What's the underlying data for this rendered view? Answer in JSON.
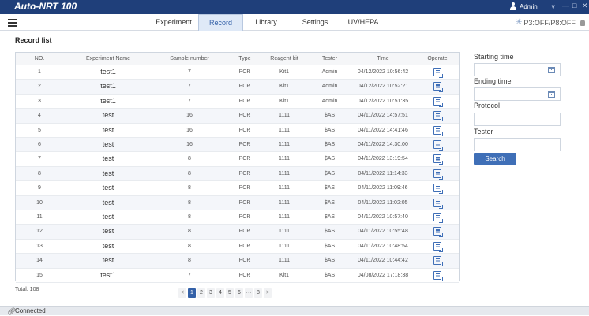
{
  "app": {
    "title": "Auto-NRT 100",
    "user": "Admin",
    "chevron": "∨",
    "win_controls": [
      "—",
      "□",
      "✕"
    ]
  },
  "nav": {
    "menu_icon": "hamburger-icon",
    "tabs": [
      {
        "label": "Experiment",
        "active": false
      },
      {
        "label": "Record",
        "active": true
      },
      {
        "label": "Library",
        "active": false
      },
      {
        "label": "Settings",
        "active": false
      },
      {
        "label": "UV/HEPA",
        "active": false
      }
    ],
    "status": "P3:OFF/P8:OFF"
  },
  "record_list": {
    "title": "Record list",
    "columns": [
      "NO.",
      "Experiment Name",
      "Sample number",
      "Type",
      "Reagent kit",
      "Tester",
      "Time",
      "Operate"
    ],
    "rows": [
      [
        "1",
        "test1",
        "7",
        "PCR",
        "Kit1",
        "Admin",
        "04/12/2022 10:56:42"
      ],
      [
        "2",
        "test1",
        "7",
        "PCR",
        "Kit1",
        "Admin",
        "04/12/2022 10:52:21"
      ],
      [
        "3",
        "test1",
        "7",
        "PCR",
        "Kit1",
        "Admin",
        "04/12/2022 10:51:35"
      ],
      [
        "4",
        "test",
        "16",
        "PCR",
        "1111",
        "$AS",
        "04/11/2022 14:57:51"
      ],
      [
        "5",
        "test",
        "16",
        "PCR",
        "1111",
        "$AS",
        "04/11/2022 14:41:46"
      ],
      [
        "6",
        "test",
        "16",
        "PCR",
        "1111",
        "$AS",
        "04/11/2022 14:30:00"
      ],
      [
        "7",
        "test",
        "8",
        "PCR",
        "1111",
        "$AS",
        "04/11/2022 13:19:54"
      ],
      [
        "8",
        "test",
        "8",
        "PCR",
        "1111",
        "$AS",
        "04/11/2022 11:14:33"
      ],
      [
        "9",
        "test",
        "8",
        "PCR",
        "1111",
        "$AS",
        "04/11/2022 11:09:46"
      ],
      [
        "10",
        "test",
        "8",
        "PCR",
        "1111",
        "$AS",
        "04/11/2022 11:02:05"
      ],
      [
        "11",
        "test",
        "8",
        "PCR",
        "1111",
        "$AS",
        "04/11/2022 10:57:40"
      ],
      [
        "12",
        "test",
        "8",
        "PCR",
        "1111",
        "$AS",
        "04/11/2022 10:55:48"
      ],
      [
        "13",
        "test",
        "8",
        "PCR",
        "1111",
        "$AS",
        "04/11/2022 10:48:54"
      ],
      [
        "14",
        "test",
        "8",
        "PCR",
        "1111",
        "$AS",
        "04/11/2022 10:44:42"
      ],
      [
        "15",
        "test1",
        "7",
        "PCR",
        "Kit1",
        "$AS",
        "04/08/2022 17:18:38"
      ]
    ],
    "operate_icon": "record-detail-icon",
    "total": "Total: 108",
    "pagination": {
      "prev": "<",
      "pages": [
        "1",
        "2",
        "3",
        "4",
        "5",
        "6",
        "···",
        "8"
      ],
      "next": ">",
      "current": "1"
    }
  },
  "filter": {
    "starting_time": {
      "label": "Starting time",
      "value": ""
    },
    "ending_time": {
      "label": "Ending time",
      "value": ""
    },
    "protocol": {
      "label": "Protocol",
      "value": ""
    },
    "tester": {
      "label": "Tester",
      "value": ""
    },
    "search_label": "Search"
  },
  "footer": {
    "status": "Connected"
  },
  "colors": {
    "titlebar": "#1f3f7a",
    "accent": "#3461a8",
    "active_tab_bg": "#dfe9f7"
  }
}
